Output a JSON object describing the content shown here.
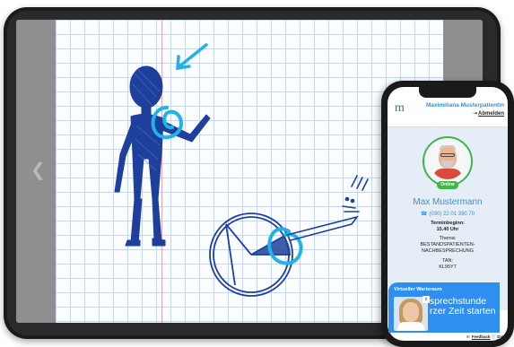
{
  "phone": {
    "brand_logo": "m",
    "patient_name": "Maximiliana Musterpatientin",
    "logout_label": "Abmelden",
    "doctor": {
      "status": "Online",
      "name": "Max Mustermann",
      "phone": "(030) 22 01 390 70",
      "appointment_label": "Terminbeginn:",
      "appointment_time": "15.40 Uhr",
      "topic_label": "Thema:",
      "topic_line1": "BESTANDSPATIENTEN-",
      "topic_line2": "NACHBESPRECHUNG",
      "tan_label": "TAN:",
      "tan_value": "KL95Y7"
    },
    "waiting_room": {
      "title": "Virtueller Warteraum",
      "text_line1": "sprechstunde",
      "text_line2": "rzer Zeit starten",
      "close_label": "x"
    },
    "footer": {
      "feedback_label": "Feedback",
      "other_label": "Date"
    }
  },
  "colors": {
    "accent_blue": "#2f8ff0",
    "online_green": "#3fb54a",
    "ink_blue": "#1e3f9c",
    "highlight_cyan": "#1fb3e8"
  }
}
